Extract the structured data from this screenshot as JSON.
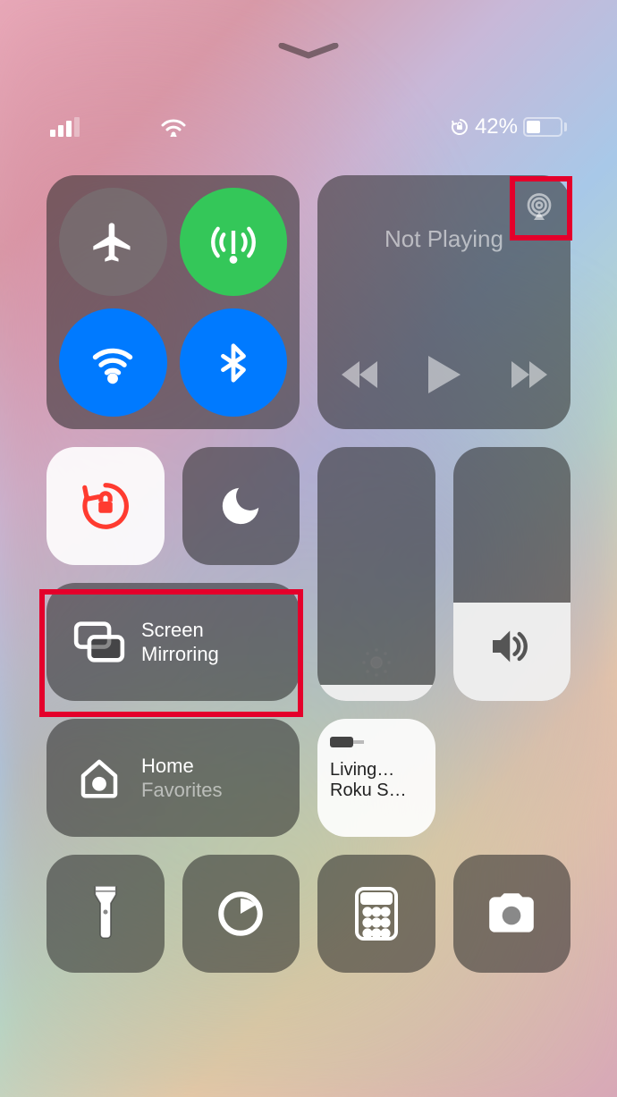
{
  "status": {
    "battery_percent": "42%",
    "orientation_lock": "locked"
  },
  "media": {
    "title": "Not Playing"
  },
  "screen_mirroring": {
    "line1": "Screen",
    "line2": "Mirroring"
  },
  "home": {
    "line1": "Home",
    "line2": "Favorites"
  },
  "device": {
    "line1": "Living…",
    "line2": "Roku S…"
  }
}
